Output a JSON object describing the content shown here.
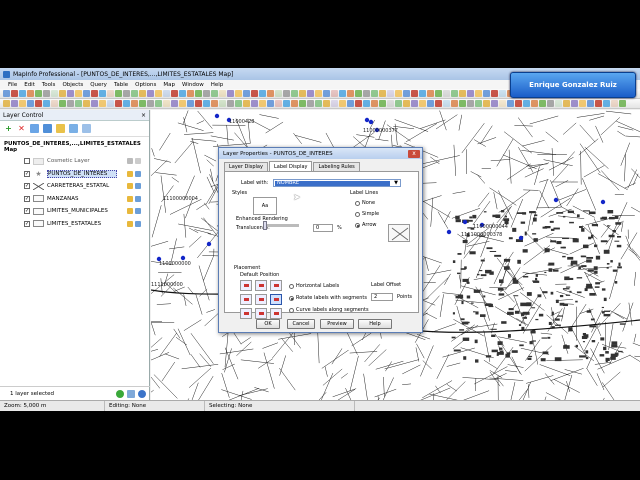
{
  "window": {
    "title": "MapInfo Professional - [PUNTOS_DE_INTERES,...,LIMITES_ESTATALES Map]"
  },
  "presenter": {
    "name": "Enrique Gonzalez Ruiz"
  },
  "menu": [
    "File",
    "Edit",
    "Tools",
    "Objects",
    "Query",
    "Table",
    "Options",
    "Map",
    "Window",
    "Help"
  ],
  "layer_control": {
    "title": "Layer Control",
    "pin": "×",
    "map_name": "PUNTOS_DE_INTERES,...,LIMITES_ESTATALES Map",
    "layers": [
      {
        "name": "Cosmetic Layer",
        "checked": false
      },
      {
        "name": "PUNTOS_DE_INTERES",
        "checked": true
      },
      {
        "name": "CARRETERAS_ESTATAL",
        "checked": true
      },
      {
        "name": "MANZANAS",
        "checked": true
      },
      {
        "name": "LIMITES_MUNICIPALES",
        "checked": true
      },
      {
        "name": "LIMITES_ESTATALES",
        "checked": true
      }
    ],
    "footer": "1 layer selected"
  },
  "status": {
    "zoom": "Zoom: 5,000 m",
    "editing": "Editing: None",
    "selecting": "Selecting: None"
  },
  "map_labels": [
    "11000428",
    "11100000004",
    "11000000377",
    "11000000044",
    "1111000000378",
    "1100000000",
    "1111000000"
  ],
  "dialog": {
    "title": "Layer Properties - PUNTOS_DE_INTERES",
    "close": "x",
    "tabs": [
      "Layer Display",
      "Label Display",
      "Labeling Rules"
    ],
    "label_with_label": "Label with:",
    "label_with_value": "NOMBRE",
    "styles_label": "Styles",
    "style_sample": "Aa",
    "label_lines": "Label Lines",
    "line_options": [
      {
        "label": "None",
        "on": false
      },
      {
        "label": "Simple",
        "on": false
      },
      {
        "label": "Arrow",
        "on": true
      }
    ],
    "enhanced_rendering": "Enhanced Rendering",
    "translucency_label": "Translucency:",
    "translucency_value": "0",
    "translucency_unit": "%",
    "placement": "Placement",
    "default_position": "Default Position",
    "orientation_options": [
      {
        "label": "Horizontal Labels",
        "on": false
      },
      {
        "label": "Rotate labels with segments",
        "on": true
      },
      {
        "label": "Curve labels along segments",
        "on": false
      }
    ],
    "label_offset": "Label Offset",
    "offset_value": "2",
    "offset_unit": "Points",
    "buttons": {
      "ok": "OK",
      "cancel": "Cancel",
      "preview": "Preview",
      "help": "Help"
    }
  }
}
